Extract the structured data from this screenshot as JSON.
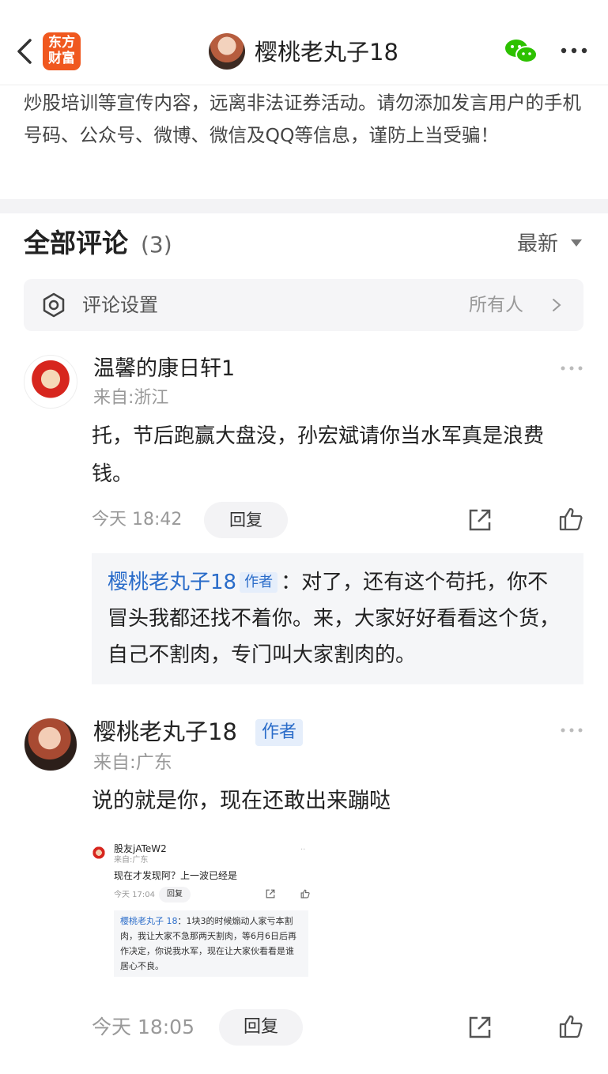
{
  "header": {
    "logo_line1": "东方",
    "logo_line2": "财富",
    "title": "樱桃老丸子18"
  },
  "notice": "炒股培训等宣传内容，远离非法证券活动。请勿添加发言用户的手机号码、公众号、微博、微信及QQ等信息，谨防上当受骗！",
  "comments_header": {
    "title": "全部评论",
    "count": "(3)",
    "sort": "最新"
  },
  "settings": {
    "label": "评论设置",
    "value": "所有人"
  },
  "comments": [
    {
      "user": "温馨的康日轩1",
      "from": "来自:浙江",
      "body": "托，节后跑赢大盘没，孙宏斌请你当水军真是浪费钱。",
      "time": "今天 18:42",
      "reply_label": "回复",
      "reply": {
        "name": "樱桃老丸子18",
        "tag": "作者",
        "sep": "：",
        "text": "对了，还有这个苟托，你不冒头我都还找不着你。来，大家好好看看这个货，自己不割肉，专门叫大家割肉的。"
      }
    },
    {
      "user": "樱桃老丸子18",
      "tag": "作者",
      "from": "来自:广东",
      "body": "说的就是你，现在还敢出来蹦哒",
      "time": "今天 18:05",
      "reply_label": "回复",
      "embedded": {
        "user": "股友jATeW2",
        "from": "来自:广东",
        "body": "现在才发现阿？上一波已经是",
        "time": "今天 17:04",
        "reply_label": "回复",
        "reply_name": "樱桃老丸子 18",
        "reply_text": "：1块3的时候煽动人家亏本割肉，我让大家不急那两天割肉，等6月6日后再作决定，你说我水军，现在让大家伙看看是谁居心不良。"
      }
    }
  ],
  "icons": [
    "back-icon",
    "wechat-icon",
    "more-icon",
    "gear-icon",
    "chevron-right-icon",
    "share-icon",
    "like-icon"
  ],
  "colors": {
    "brand": "#f0581f",
    "link": "#2a6cc9",
    "wechat": "#2dc100"
  }
}
